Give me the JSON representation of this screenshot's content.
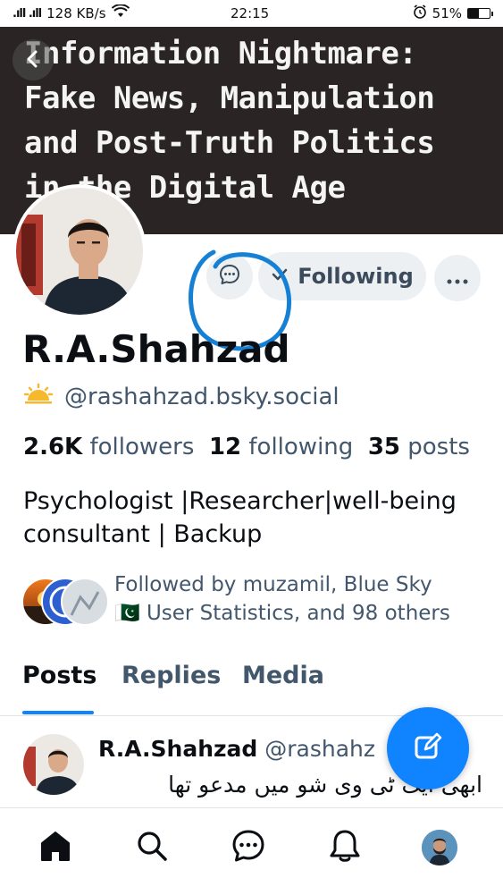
{
  "status_bar": {
    "signal": ".ıll .ıll",
    "network_speed": "128 KB/s",
    "time": "22:15",
    "alarm_icon": "alarm-clock-icon",
    "battery_percent": "51%",
    "battery_level": 0.51
  },
  "banner": {
    "lines": [
      "Information Nightmare:",
      "Fake News, Manipulation",
      "and Post-Truth Politics",
      "in the Digital Age"
    ]
  },
  "profile": {
    "display_name": "R.A.Shahzad",
    "handle": "@rashahzad.bsky.social",
    "handle_icon": "sun-icon",
    "following_label": "Following",
    "stats": {
      "followers_count": "2.6K",
      "followers_label": "followers",
      "following_count": "12",
      "following_label": "following",
      "posts_count": "35",
      "posts_label": "posts"
    },
    "bio_line1": "Psychologist |Researcher|well-being",
    "bio_line2": "consultant | Backup",
    "followed_by_line1": "Followed by muzamil, Blue Sky",
    "followed_by_line2": "🇵🇰 User Statistics, and 98 others"
  },
  "tabs": [
    "Posts",
    "Replies",
    "Media"
  ],
  "post": {
    "author_name": "R.A.Shahzad",
    "author_handle": "@rashahz",
    "author_handle_tail": "h",
    "text": "ابھی ایک ٹی وی شو میں مدعو تھا"
  },
  "nav": [
    "home-icon",
    "search-icon",
    "chat-icon",
    "bell-icon",
    "profile-avatar"
  ],
  "colors": {
    "accent": "#1083fe",
    "muted_text": "#42576c",
    "button_bg": "#edf0f3",
    "annotation_circle": "#1681d4"
  }
}
